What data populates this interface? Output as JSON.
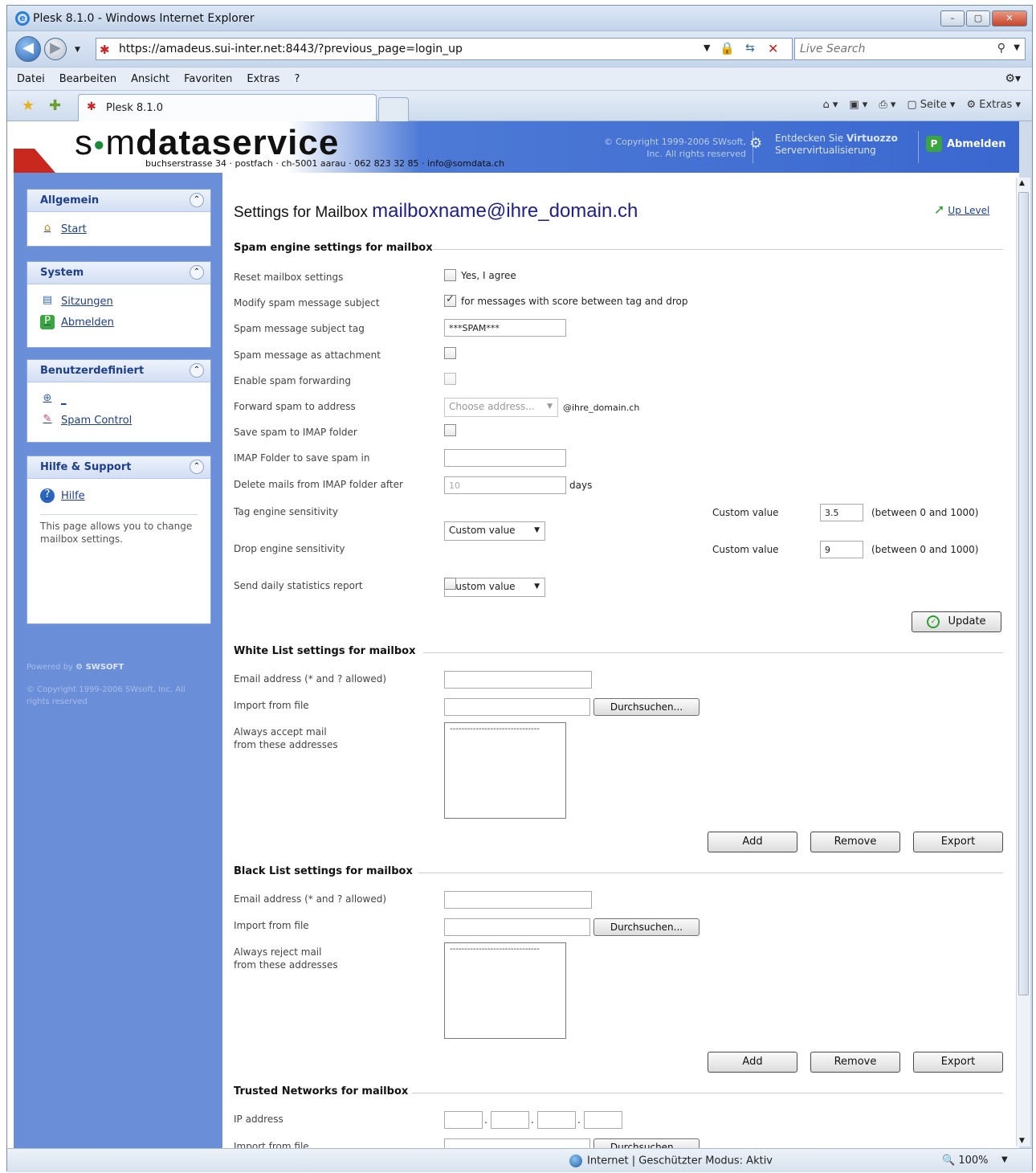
{
  "window": {
    "title": "Plesk 8.1.0 - Windows Internet Explorer"
  },
  "browser": {
    "url": "https://amadeus.sui-inter.net:8443/?previous_page=login_up",
    "search_placeholder": "Live Search",
    "menu": [
      "Datei",
      "Bearbeiten",
      "Ansicht",
      "Favoriten",
      "Extras",
      "?"
    ],
    "tab_label": "Plesk 8.1.0",
    "cmd": {
      "page": "Seite",
      "tools": "Extras"
    }
  },
  "header": {
    "logo_pre": "s",
    "logo_dot": "●",
    "logo_m": "m",
    "logo_bold": "dataservice",
    "address": "buchserstrasse 34 · postfach · ch-5001 aarau · 062 823 32 85 · info@somdata.ch",
    "copyright": "© Copyright 1999-2006 SWsoft, Inc. All rights reserved",
    "virtuozzo_pre": "Entdecken Sie ",
    "virtuozzo_bold": "Virtuozzo",
    "virtuozzo_sub": "Servervirtualisierung",
    "logout": "Abmelden"
  },
  "sidebar": {
    "general": {
      "title": "Allgemein",
      "items": [
        {
          "label": "Start"
        }
      ]
    },
    "system": {
      "title": "System",
      "items": [
        {
          "label": "Sitzungen"
        },
        {
          "label": "Abmelden"
        }
      ]
    },
    "custom": {
      "title": "Benutzerdefiniert",
      "items": [
        {
          "label": "_"
        },
        {
          "label": "Spam Control"
        }
      ]
    },
    "help": {
      "title": "Hilfe & Support",
      "items": [
        {
          "label": "Hilfe"
        }
      ],
      "description": "This page allows you to change mailbox settings."
    },
    "powered_by": "Powered by",
    "powered_brand": "SWSOFT",
    "footer_copyright": "© Copyright 1999-2006 SWsoft, Inc. All rights reserved"
  },
  "main": {
    "title_prefix": "Settings for Mailbox",
    "mailbox": "mailboxname@ihre_domain.ch",
    "up_level": "Up Level",
    "spam": {
      "section": "Spam engine settings for mailbox",
      "reset_label": "Reset mailbox settings",
      "reset_text": "Yes, I agree",
      "modify_label": "Modify spam message subject",
      "modify_text": "for messages with score between tag and drop",
      "tag_label": "Spam message subject tag",
      "tag_value": "***SPAM***",
      "attach_label": "Spam message as attachment",
      "fwd_enable_label": "Enable spam forwarding",
      "fwd_addr_label": "Forward spam to address",
      "fwd_addr_value": "Choose address...",
      "fwd_domain": "@ihre_domain.ch",
      "imap_save_label": "Save spam to IMAP folder",
      "imap_folder_label": "IMAP Folder to save spam in",
      "imap_folder_value": "",
      "delete_label": "Delete mails from IMAP folder after",
      "delete_value": "10",
      "days": "days",
      "tag_sens_label": "Tag engine sensitivity",
      "tag_sens_value": "Custom value",
      "tag_custom_label": "Custom value",
      "tag_custom_value": "3.5",
      "tag_range": "(between 0 and 1000)",
      "drop_sens_label": "Drop engine sensitivity",
      "drop_sens_value": "Custom value",
      "drop_custom_label": "Custom value",
      "drop_custom_value": "9",
      "drop_range": "(between 0 and 1000)",
      "daily_label": "Send daily statistics report",
      "update": "Update"
    },
    "whitelist": {
      "section": "White List settings for mailbox",
      "email_label": "Email address (* and ? allowed)",
      "import_label": "Import from file",
      "browse": "Durchsuchen...",
      "accept_label_1": "Always accept mail",
      "accept_label_2": "from these addresses",
      "list_value": "-------------------------------",
      "add": "Add",
      "remove": "Remove",
      "export": "Export"
    },
    "blacklist": {
      "section": "Black List settings for mailbox",
      "email_label": "Email address (* and ? allowed)",
      "import_label": "Import from file",
      "browse": "Durchsuchen...",
      "reject_label_1": "Always reject mail",
      "reject_label_2": "from these addresses",
      "list_value": "-------------------------------",
      "add": "Add",
      "remove": "Remove",
      "export": "Export"
    },
    "trusted": {
      "section": "Trusted Networks for mailbox",
      "ip_label": "IP address",
      "import_label": "Import from file",
      "browse": "Durchsuchen..."
    }
  },
  "status": {
    "zone": "Internet | Geschützter Modus: Aktiv",
    "zoom": "100%"
  }
}
